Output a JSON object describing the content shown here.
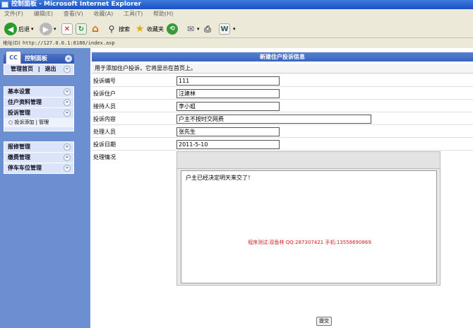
{
  "window": {
    "title": "控制面板 - Microsoft Internet Explorer"
  },
  "menu": [
    "文件(F)",
    "编辑(E)",
    "查看(V)",
    "收藏(A)",
    "工具(T)",
    "帮助(H)"
  ],
  "toolbar": {
    "back_label": "后退",
    "search_label": "搜索",
    "favorites_label": "收藏夹"
  },
  "address": {
    "label": "地址(D)",
    "url": "http://127.0.0.1:8180/index.asp"
  },
  "sidebar": {
    "title": "控制面板",
    "logo_text": "CC",
    "home_link": "管理首页",
    "logout_link": "退出",
    "separator": "|",
    "sections": [
      {
        "label": "基本设置"
      },
      {
        "label": "住户资料管理"
      },
      {
        "label": "投诉管理",
        "sub": "投诉添加 | 管理"
      }
    ],
    "sections2": [
      {
        "label": "报修管理"
      },
      {
        "label": "缴费管理"
      },
      {
        "label": "停车车位管理"
      }
    ]
  },
  "content": {
    "title": "新建住户投诉信息",
    "description": "用于添加住户投诉，它将显示在首页上。",
    "fields": [
      {
        "label": "投诉编号",
        "value": "111"
      },
      {
        "label": "投诉住户",
        "value": "汪建林"
      },
      {
        "label": "接待人员",
        "value": "李小姐"
      },
      {
        "label": "投诉内容",
        "value": "户主不按时交网费"
      },
      {
        "label": "处理人员",
        "value": "张先生"
      },
      {
        "label": "投诉日期",
        "value": "2011-5-10"
      }
    ],
    "handling_label": "处理情况",
    "handling_text": "户主已经决定明天来交了！",
    "credit": "程序测试:双鱼林 QQ:287307421 手机:13558690869",
    "submit_label": "提交"
  }
}
